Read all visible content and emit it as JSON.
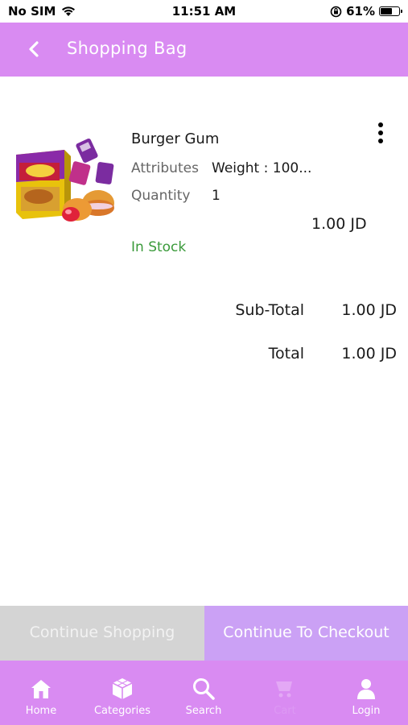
{
  "status_bar": {
    "carrier": "No SIM",
    "time": "11:51 AM",
    "battery": "61%",
    "battery_level": 0.61
  },
  "header": {
    "title": "Shopping Bag",
    "background": "#d98bf2"
  },
  "cart_item": {
    "name": "Burger Gum",
    "attributes_label": "Attributes",
    "attributes_value": "Weight : 100...",
    "quantity_label": "Quantity",
    "quantity_value": "1",
    "price": "1.00 JD",
    "stock_status": "In Stock",
    "stock_color": "#3a9a3a"
  },
  "totals": {
    "subtotal_label": "Sub-Total",
    "subtotal_value": "1.00 JD",
    "total_label": "Total",
    "total_value": "1.00 JD"
  },
  "actions": {
    "continue_shopping": "Continue Shopping",
    "continue_checkout": "Continue To Checkout"
  },
  "tab_bar": {
    "items": [
      {
        "label": "Home",
        "icon": "home-icon"
      },
      {
        "label": "Categories",
        "icon": "categories-icon"
      },
      {
        "label": "Search",
        "icon": "search-icon"
      },
      {
        "label": "Cart",
        "icon": "cart-icon"
      },
      {
        "label": "Login",
        "icon": "user-icon"
      }
    ]
  }
}
